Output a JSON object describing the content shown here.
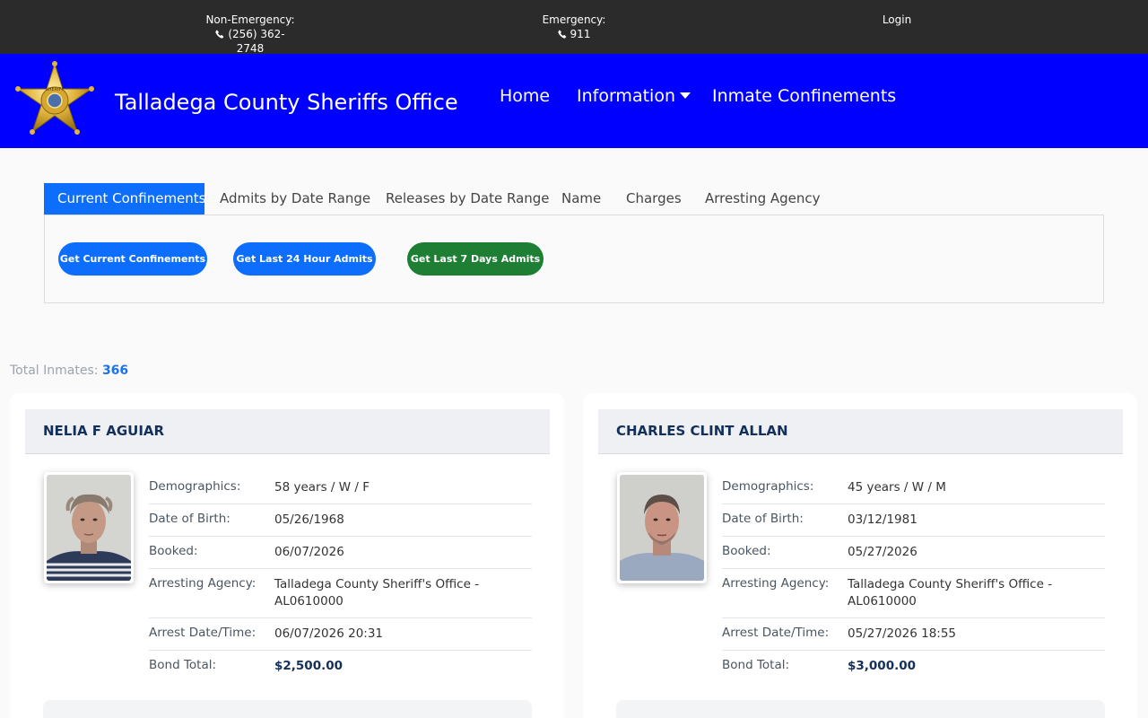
{
  "topbar": {
    "non_emergency_label": "Non-Emergency:",
    "non_emergency_phone": "(256) 362-2748",
    "emergency_label": "Emergency:",
    "emergency_phone": "911",
    "login": "Login"
  },
  "header": {
    "title": "Talladega County Sheriffs Office",
    "badge_text": "SHERIFF",
    "nav": {
      "home": "Home",
      "information": "Information",
      "inmate_confinements": "Inmate Confinements"
    }
  },
  "tabs": [
    "Current Confinements",
    "Admits by Date Range",
    "Releases by Date Range",
    "Name",
    "Charges",
    "Arresting Agency"
  ],
  "buttons": {
    "current": "Get Current Confinements",
    "last24": "Get Last 24 Hour Admits",
    "last7": "Get Last 7 Days Admits"
  },
  "total": {
    "label": "Total Inmates:",
    "value": "366"
  },
  "field_labels": {
    "demographics": "Demographics:",
    "dob": "Date of Birth:",
    "booked": "Booked:",
    "agency": "Arresting Agency:",
    "arrest": "Arrest Date/Time:",
    "bond": "Bond Total:"
  },
  "inmates": [
    {
      "name": "NELIA F AGUIAR",
      "demographics": "58 years / W / F",
      "dob": "05/26/1968",
      "booked": "06/07/2026",
      "agency": "Talladega County Sheriff's Office - AL0610000",
      "arrest": "06/07/2026 20:31",
      "bond": "$2,500.00"
    },
    {
      "name": "CHARLES CLINT ALLAN",
      "demographics": "45 years / W / M",
      "dob": "03/12/1981",
      "booked": "05/27/2026",
      "agency": "Talladega County Sheriff's Office - AL0610000",
      "arrest": "05/27/2026 18:55",
      "bond": "$3,000.00"
    }
  ],
  "colors": {
    "topbar": "#2b2b2b",
    "header": "#0000ff",
    "primary": "#0d6efd",
    "success": "#1e7e34",
    "name": "#14305a"
  }
}
